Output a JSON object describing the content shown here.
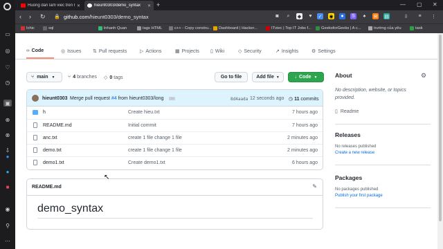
{
  "browser": {
    "tabs": [
      {
        "label": "Huong dan lam viec tren h",
        "favicon": "youtube-icon"
      },
      {
        "label": "hieunt0303/demo_syntax",
        "favicon": "github-icon"
      }
    ],
    "url_host": "github.com",
    "url_path": "/hieunt0303/demo_syntax",
    "bookmarks": [
      "Ichic",
      "sql",
      "lnhanh Quan",
      "tags HTML",
      "c++ - Copy constru...",
      "Dashboard | Hacker...",
      "ITviec | Top IT Jobs f...",
      "GeeksforGeeks | A c...",
      "trường của yêu",
      "task"
    ]
  },
  "repo": {
    "nav": [
      {
        "label": "Code",
        "icon": "code-icon"
      },
      {
        "label": "Issues",
        "icon": "issue-icon"
      },
      {
        "label": "Pull requests",
        "icon": "pull-request-icon"
      },
      {
        "label": "Actions",
        "icon": "play-icon"
      },
      {
        "label": "Projects",
        "icon": "table-icon"
      },
      {
        "label": "Wiki",
        "icon": "book-icon"
      },
      {
        "label": "Security",
        "icon": "shield-icon"
      },
      {
        "label": "Insights",
        "icon": "graph-icon"
      },
      {
        "label": "Settings",
        "icon": "gear-icon"
      }
    ],
    "branch": "main",
    "branches_count": "4",
    "branches_label": "branches",
    "tags_count": "0",
    "tags_label": "tags",
    "go_to_file": "Go to file",
    "add_file": "Add file",
    "code_button": "Code"
  },
  "commit": {
    "user": "hieunt0303",
    "message_prefix": "Merge pull request",
    "pr": "#4",
    "message_suffix": "from hieunt0303/long",
    "dots": "...",
    "hash": "8d4aada",
    "time": "12 seconds ago",
    "count": "11",
    "count_label": "commits"
  },
  "files": [
    {
      "name": "h",
      "type": "dir",
      "message": "Create hieu.txt",
      "time": "7 hours ago"
    },
    {
      "name": "README.md",
      "type": "file",
      "message": "Initial commit",
      "time": "7 hours ago"
    },
    {
      "name": "anc.txt",
      "type": "file",
      "message": "create 1 file change 1 file",
      "time": "2 minutes ago"
    },
    {
      "name": "demo.txt",
      "type": "file",
      "message": "create 1 file change 1 file",
      "time": "2 minutes ago"
    },
    {
      "name": "demo1.txt",
      "type": "file",
      "message": "Create demo1.txt",
      "time": "6 hours ago"
    }
  ],
  "readme": {
    "title": "README.md",
    "heading": "demo_syntax"
  },
  "sidebar": {
    "about_title": "About",
    "description": "No description, website, or topics provided.",
    "readme_link": "Readme",
    "releases_title": "Releases",
    "no_releases": "No releases published",
    "create_release": "Create a new release",
    "packages_title": "Packages",
    "no_packages": "No packages published",
    "publish_package": "Publish your first package"
  },
  "colors": {
    "accent": "#0969da",
    "code_button": "#2da44e",
    "nav_underline": "#fd8c73",
    "commit_bar": "#ddf4ff"
  }
}
